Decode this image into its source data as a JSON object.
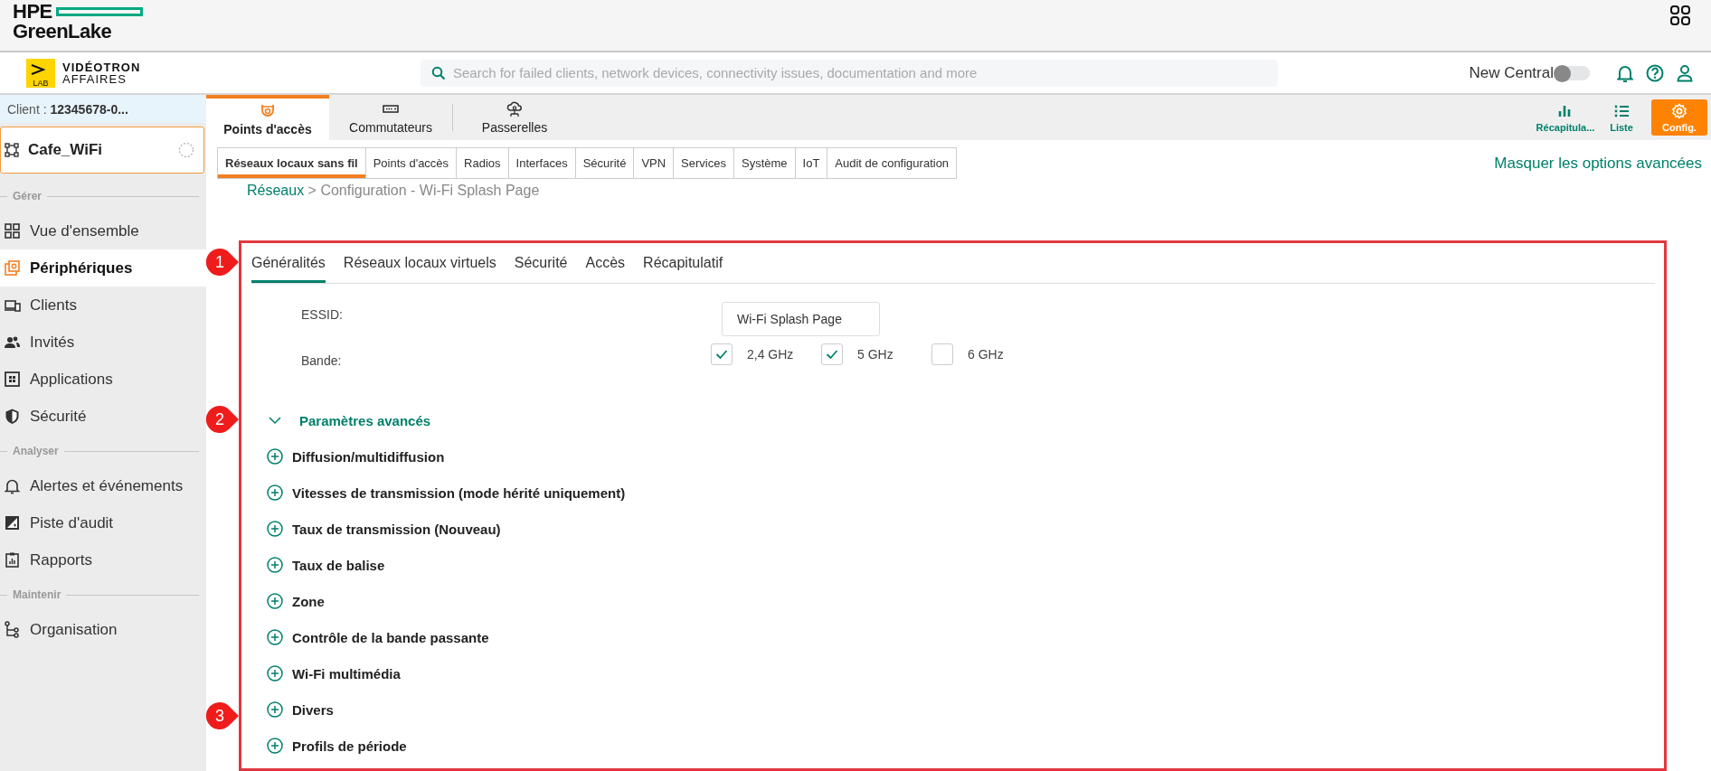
{
  "header": {
    "brand_line1": "HPE",
    "brand_line2": "GreenLake"
  },
  "topbar": {
    "logo_badge": "LAB",
    "company_line1": "VIDÉOTRON",
    "company_line2": "AFFAIRES",
    "search": {
      "placeholder": "Search for failed clients, network devices, connectivity issues, documentation and more"
    },
    "new_central": {
      "label": "New Central",
      "on": false
    }
  },
  "sidebar": {
    "client_label": "Client :",
    "client_value": "12345678-0...",
    "site": "Cafe_WiFi",
    "sections": [
      {
        "title": "Gérer",
        "items": [
          {
            "label": "Vue d'ensemble",
            "selected": false
          },
          {
            "label": "Périphériques",
            "selected": true
          },
          {
            "label": "Clients",
            "selected": false
          },
          {
            "label": "Invités",
            "selected": false
          },
          {
            "label": "Applications",
            "selected": false
          },
          {
            "label": "Sécurité",
            "selected": false
          }
        ]
      },
      {
        "title": "Analyser",
        "items": [
          {
            "label": "Alertes et événements",
            "selected": false
          },
          {
            "label": "Piste d'audit",
            "selected": false
          },
          {
            "label": "Rapports",
            "selected": false
          }
        ]
      },
      {
        "title": "Maintenir",
        "items": [
          {
            "label": "Organisation",
            "selected": false
          }
        ]
      }
    ]
  },
  "device_tabs": [
    {
      "label": "Points d'accès",
      "selected": true
    },
    {
      "label": "Commutateurs",
      "selected": false
    },
    {
      "label": "Passerelles",
      "selected": false
    }
  ],
  "view_buttons": [
    {
      "label": "Récapitula...",
      "selected": false
    },
    {
      "label": "Liste",
      "selected": false
    },
    {
      "label": "Config.",
      "selected": true
    }
  ],
  "config_tabs": [
    {
      "label": "Réseaux locaux sans fil",
      "selected": true
    },
    {
      "label": "Points d'accès",
      "selected": false
    },
    {
      "label": "Radios",
      "selected": false
    },
    {
      "label": "Interfaces",
      "selected": false
    },
    {
      "label": "Sécurité",
      "selected": false
    },
    {
      "label": "VPN",
      "selected": false
    },
    {
      "label": "Services",
      "selected": false
    },
    {
      "label": "Système",
      "selected": false
    },
    {
      "label": "IoT",
      "selected": false
    },
    {
      "label": "Audit de configuration",
      "selected": false
    }
  ],
  "advanced_link": "Masquer les options avancées",
  "breadcrumb": {
    "link": "Réseaux",
    "rest": "> Configuration - Wi-Fi Splash Page"
  },
  "form": {
    "tabs": [
      {
        "label": "Généralités",
        "selected": true
      },
      {
        "label": "Réseaux locaux virtuels",
        "selected": false
      },
      {
        "label": "Sécurité",
        "selected": false
      },
      {
        "label": "Accès",
        "selected": false
      },
      {
        "label": "Récapitulatif",
        "selected": false
      }
    ],
    "essid": {
      "label": "ESSID:",
      "value": "Wi-Fi Splash Page"
    },
    "band": {
      "label": "Bande:",
      "options": [
        {
          "label": "2,4 GHz",
          "checked": true
        },
        {
          "label": "5 GHz",
          "checked": true
        },
        {
          "label": "6 GHz",
          "checked": false
        }
      ]
    },
    "advanced": {
      "label": "Paramètres avancés",
      "expanded": true,
      "sections": [
        {
          "label": "Diffusion/multidiffusion",
          "expanded": false
        },
        {
          "label": "Vitesses de transmission (mode hérité uniquement)",
          "expanded": false
        },
        {
          "label": "Taux de transmission (Nouveau)",
          "expanded": false
        },
        {
          "label": "Taux de balise",
          "expanded": false
        },
        {
          "label": "Zone",
          "expanded": false
        },
        {
          "label": "Contrôle de la bande passante",
          "expanded": false
        },
        {
          "label": "Wi-Fi multimédia",
          "expanded": false
        },
        {
          "label": "Divers",
          "expanded": false
        },
        {
          "label": "Profils de période",
          "expanded": false
        }
      ]
    }
  },
  "annotations": [
    {
      "label": "1"
    },
    {
      "label": "2"
    },
    {
      "label": "3"
    }
  ]
}
